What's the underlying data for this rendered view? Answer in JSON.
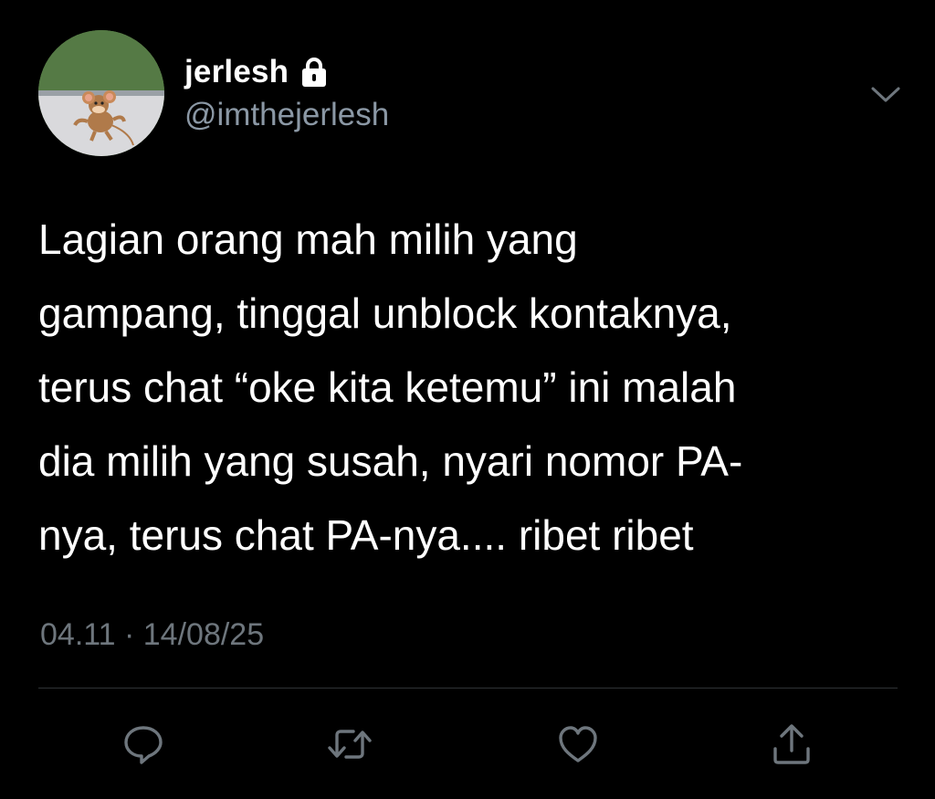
{
  "user": {
    "display_name": "jerlesh",
    "handle": "@imthejerlesh",
    "avatar_icon": "avatar-mouse-cartoon",
    "protected_icon": "lock-icon"
  },
  "tweet": {
    "lines": [
      "Lagian orang mah milih yang",
      "gampang, tinggal unblock kontaknya,",
      "terus chat “oke kita ketemu” ini malah",
      "dia milih yang susah, nyari nomor PA-",
      "nya, terus chat PA-nya.... ribet ribet"
    ],
    "timestamp": "04.11 · 14/08/25"
  },
  "actions": [
    {
      "name": "reply",
      "icon": "reply-icon"
    },
    {
      "name": "retweet",
      "icon": "retweet-icon"
    },
    {
      "name": "like",
      "icon": "heart-icon"
    },
    {
      "name": "share",
      "icon": "share-icon"
    }
  ],
  "colors": {
    "background": "#000000",
    "text": "#ffffff",
    "secondary_text": "#8b98a5",
    "icon": "#6e767d",
    "divider": "#2f3336"
  }
}
